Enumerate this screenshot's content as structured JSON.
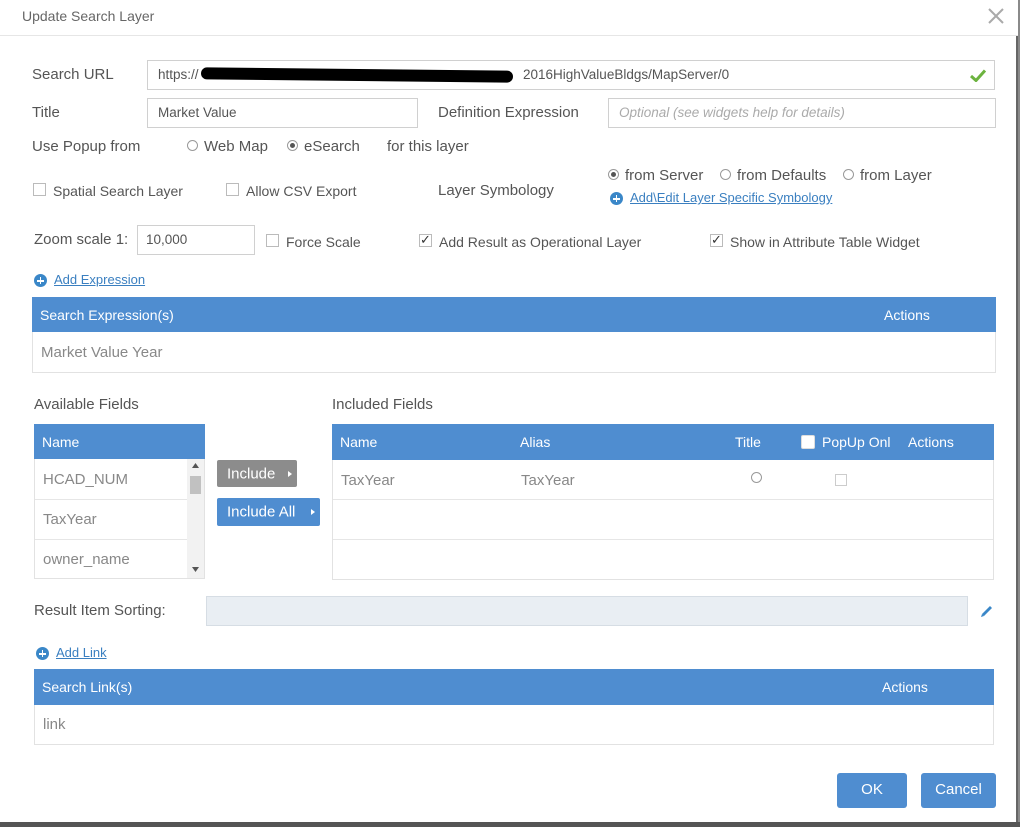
{
  "dialog": {
    "title": "Update Search Layer"
  },
  "search_url": {
    "label": "Search URL",
    "value": "https://",
    "value_suffix": "2016HighValueBldgs/MapServer/0",
    "status": "valid"
  },
  "title_field": {
    "label": "Title",
    "value": "Market Value"
  },
  "definition_expression": {
    "label": "Definition Expression",
    "placeholder": "Optional (see widgets help for details)"
  },
  "popup": {
    "label": "Use Popup from",
    "options": [
      {
        "label": "Web Map",
        "selected": false
      },
      {
        "label": "eSearch",
        "selected": true
      }
    ],
    "suffix": "for this layer"
  },
  "spatial_search": {
    "label": "Spatial Search Layer",
    "checked": false
  },
  "allow_csv": {
    "label": "Allow CSV Export",
    "checked": false
  },
  "symbology": {
    "label": "Layer Symbology",
    "options": [
      {
        "label": "from Server",
        "selected": true
      },
      {
        "label": "from Defaults",
        "selected": false
      },
      {
        "label": "from Layer",
        "selected": false
      }
    ],
    "link": "Add\\Edit Layer Specific Symbology"
  },
  "zoom": {
    "label": "Zoom scale 1:",
    "value": "10,000"
  },
  "force_scale": {
    "label": "Force Scale",
    "checked": false
  },
  "add_result": {
    "label": "Add Result as Operational Layer",
    "checked": true
  },
  "show_attr": {
    "label": "Show in Attribute Table Widget",
    "checked": true
  },
  "add_expression_link": "Add Expression",
  "expressions_table": {
    "headers": [
      "Search Expression(s)",
      "Actions"
    ],
    "rows": [
      "Market Value Year"
    ]
  },
  "available_fields": {
    "label": "Available Fields",
    "header": "Name",
    "items": [
      "HCAD_NUM",
      "TaxYear",
      "owner_name"
    ]
  },
  "include_button": "Include",
  "include_all_button": "Include All",
  "included_fields": {
    "label": "Included Fields",
    "headers": {
      "name": "Name",
      "alias": "Alias",
      "title": "Title",
      "popup": "PopUp Onl",
      "actions": "Actions"
    },
    "rows": [
      {
        "name": "TaxYear",
        "alias": "TaxYear"
      }
    ]
  },
  "result_sorting": {
    "label": "Result Item Sorting:",
    "value": ""
  },
  "add_link": "Add Link",
  "links_table": {
    "headers": [
      "Search Link(s)",
      "Actions"
    ],
    "rows": [
      "link"
    ]
  },
  "footer": {
    "ok": "OK",
    "cancel": "Cancel"
  },
  "colors": {
    "accent": "#4f8dd0",
    "check_green": "#6cb33f",
    "button_gray": "#8c8c8c"
  }
}
